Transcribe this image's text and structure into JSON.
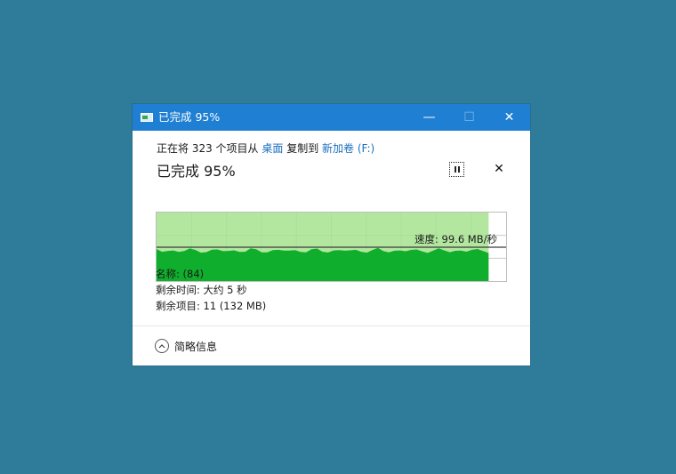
{
  "window": {
    "title": "已完成 95%",
    "minimize_glyph": "—",
    "maximize_glyph": "☐",
    "close_glyph": "✕"
  },
  "copy": {
    "prefix": "正在将 323 个项目从 ",
    "source": "桌面",
    "middle": " 复制到 ",
    "destination": "新加卷 (F:)",
    "status": "已完成 95%",
    "cancel_glyph": "✕"
  },
  "progress": {
    "percent": 95,
    "speed_label": "速度: 99.6 MB/秒"
  },
  "details": {
    "name": "名称: (84)",
    "time_remaining": "剩余时间: 大约 5 秒",
    "items_remaining": "剩余项目: 11 (132 MB)"
  },
  "footer": {
    "less_details_label": "简略信息"
  },
  "colors": {
    "accent": "#1f7fd2",
    "background": "#2e7b9a",
    "progress_light": "#a6e38f",
    "progress_dark": "#0fae2c",
    "link": "#1a6fbf"
  },
  "icons": {
    "app": "copy-dialog-icon",
    "pause": "pause-icon",
    "cancel": "close-icon",
    "expand": "chevron-up-icon"
  }
}
